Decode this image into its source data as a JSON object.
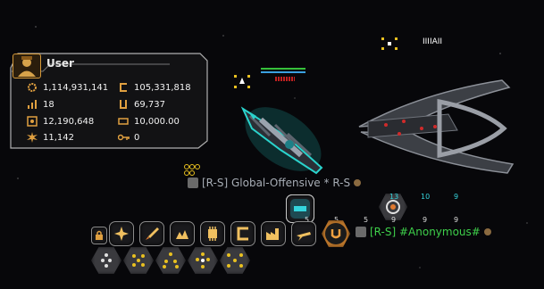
{
  "player": {
    "name": "User",
    "stats": [
      {
        "icon": "gear-burst-icon",
        "value": "1,114,931,141"
      },
      {
        "icon": "credits-icon",
        "value": "105,331,818"
      },
      {
        "icon": "level-bars-icon",
        "value": "18"
      },
      {
        "icon": "uridium-icon",
        "value": "69,737"
      },
      {
        "icon": "honor-badge-icon",
        "value": "12,190,648"
      },
      {
        "icon": "cargo-icon",
        "value": "10,000.00"
      },
      {
        "icon": "explosion-icon",
        "value": "11,142"
      },
      {
        "icon": "key-icon",
        "value": "0"
      }
    ]
  },
  "ships": {
    "own_label": "[R-S] Global-Offensive * R-S",
    "ally_label": "[R-S] #Anonymous#",
    "enemy_label": "IIIIAII",
    "own_tag_color": "#9aa0a8",
    "ally_tag_color": "#3ecf4a",
    "enemy_tag_color": "#ffffff"
  },
  "hotbar": {
    "row1": [
      {
        "icon": "lock-icon"
      },
      {
        "icon": "laser-burst-icon"
      },
      {
        "icon": "rocket-icon"
      },
      {
        "icon": "flash-icon"
      },
      {
        "icon": "cpu-icon"
      },
      {
        "icon": "c-drone-icon"
      },
      {
        "icon": "factory-icon"
      },
      {
        "icon": "jet-icon"
      },
      {
        "icon": "shield-u-icon"
      }
    ],
    "row2": [
      {
        "icon": "drone-formation-a-icon"
      },
      {
        "icon": "drone-formation-b-icon"
      },
      {
        "icon": "drone-formation-c-icon"
      },
      {
        "icon": "drone-formation-d-icon"
      },
      {
        "icon": "drone-formation-e-icon"
      }
    ],
    "abilities": [
      {
        "icon": "laser-ammo-icon",
        "count": "5"
      },
      {
        "icon": "laser-ammo-icon",
        "count": "5"
      },
      {
        "icon": "laser-ammo-icon",
        "count": "5"
      },
      {
        "icon": "crosshair-icon",
        "count": "9"
      },
      {
        "icon": "hex-shield-icon",
        "count": "9"
      },
      {
        "icon": "ring-icon",
        "count": "9"
      }
    ],
    "ability_levels": [
      "13",
      "10",
      "9"
    ]
  }
}
